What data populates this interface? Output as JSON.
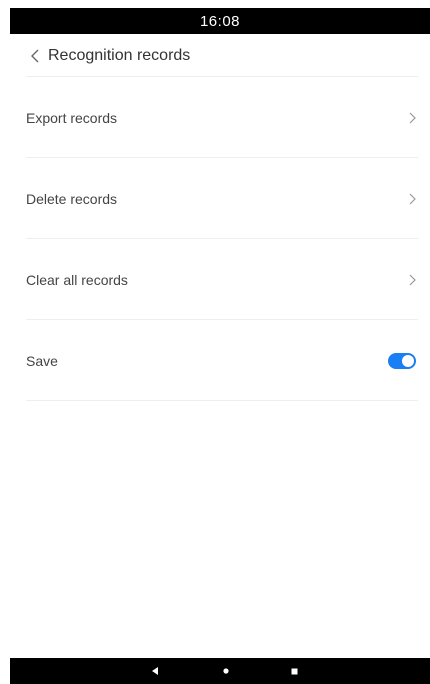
{
  "status_bar": {
    "time": "16:08"
  },
  "header": {
    "title": "Recognition records",
    "back_icon": "chevron-left-icon"
  },
  "menu": {
    "items": [
      {
        "label": "Export records",
        "icon": "chevron-right-icon"
      },
      {
        "label": "Delete records",
        "icon": "chevron-right-icon"
      },
      {
        "label": "Clear all records",
        "icon": "chevron-right-icon"
      }
    ],
    "save": {
      "label": "Save",
      "enabled": true
    }
  },
  "navigation": {
    "back_icon": "back-triangle-icon",
    "home_icon": "home-dot-icon",
    "recents_icon": "recents-square-icon"
  },
  "colors": {
    "accent": "#1a7ff2",
    "divider": "#eeeeee",
    "system_bar": "#000000"
  }
}
